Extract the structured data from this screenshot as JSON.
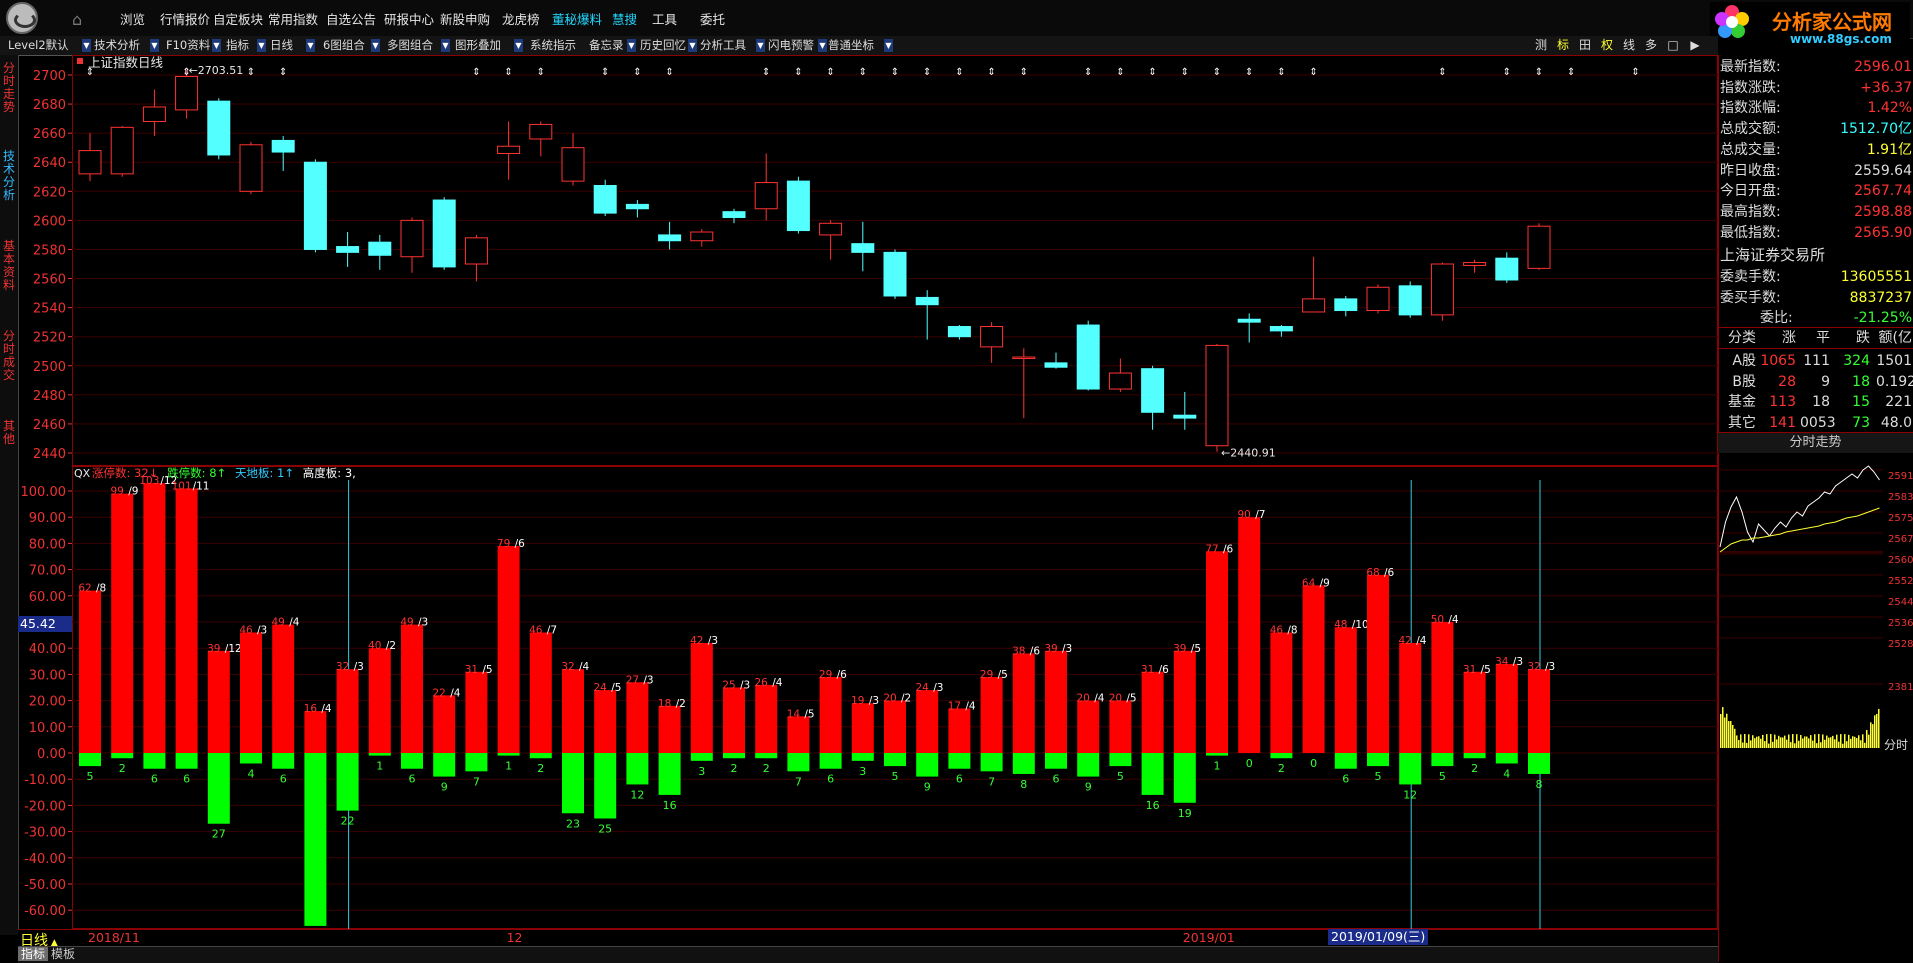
{
  "menu": {
    "items": [
      "浏览",
      "行情报价",
      "自定板块",
      "常用指数",
      "自选公告",
      "研报中心",
      "新股申购",
      "龙虎榜",
      "董秘爆料",
      "慧搜",
      "工具",
      "委托"
    ],
    "highlight": [
      "董秘爆料",
      "慧搜"
    ]
  },
  "brand": {
    "name": "分析家公式网",
    "url": "www.88gs.com"
  },
  "toolbar": {
    "items": [
      "Level2默认",
      "技术分析",
      "F10资料",
      "指标",
      "日线",
      "6图组合",
      "多图组合",
      "图形叠加",
      "系统指示",
      "备忘录",
      "历史回忆",
      "分析工具",
      "闪电预警",
      "普通坐标"
    ],
    "right": [
      "测",
      "标",
      "田",
      "权",
      "线",
      "多",
      "□",
      "▶"
    ],
    "right_active": [
      "标",
      "权"
    ]
  },
  "left_tabs": [
    "分时走势",
    "技术分析",
    "基本资料",
    "分时成交",
    "其他"
  ],
  "price_chart": {
    "title": "上证指数日线",
    "y_labels": [
      "2700",
      "2680",
      "2660",
      "2640",
      "2620",
      "2600",
      "2580",
      "2560",
      "2540",
      "2520",
      "2500",
      "2480",
      "2460",
      "2440"
    ],
    "high_label": "2703.51",
    "low_label": "2440.91",
    "candles": [
      {
        "o": 2632,
        "c": 2648,
        "h": 2660,
        "l": 2627
      },
      {
        "o": 2632,
        "c": 2664,
        "h": 2665,
        "l": 2630
      },
      {
        "o": 2668,
        "c": 2678,
        "h": 2690,
        "l": 2658
      },
      {
        "o": 2676,
        "c": 2699,
        "h": 2703.51,
        "l": 2670
      },
      {
        "o": 2682,
        "c": 2645,
        "h": 2684,
        "l": 2642
      },
      {
        "o": 2620,
        "c": 2652,
        "h": 2654,
        "l": 2618
      },
      {
        "o": 2655,
        "c": 2647,
        "h": 2658,
        "l": 2634
      },
      {
        "o": 2640,
        "c": 2580,
        "h": 2642,
        "l": 2578
      },
      {
        "o": 2582,
        "c": 2578,
        "h": 2592,
        "l": 2568
      },
      {
        "o": 2585,
        "c": 2576,
        "h": 2590,
        "l": 2566
      },
      {
        "o": 2575,
        "c": 2600,
        "h": 2602,
        "l": 2564
      },
      {
        "o": 2614,
        "c": 2568,
        "h": 2616,
        "l": 2566
      },
      {
        "o": 2570,
        "c": 2588,
        "h": 2590,
        "l": 2558
      },
      {
        "o": 2646,
        "c": 2651,
        "h": 2668,
        "l": 2628
      },
      {
        "o": 2656,
        "c": 2666,
        "h": 2668,
        "l": 2644
      },
      {
        "o": 2627,
        "c": 2650,
        "h": 2660,
        "l": 2624
      },
      {
        "o": 2624,
        "c": 2605,
        "h": 2628,
        "l": 2603
      },
      {
        "o": 2611,
        "c": 2608,
        "h": 2614,
        "l": 2602
      },
      {
        "o": 2590,
        "c": 2586,
        "h": 2599,
        "l": 2580
      },
      {
        "o": 2586,
        "c": 2592,
        "h": 2594,
        "l": 2582
      },
      {
        "o": 2606,
        "c": 2602,
        "h": 2608,
        "l": 2598
      },
      {
        "o": 2608,
        "c": 2626,
        "h": 2646,
        "l": 2600
      },
      {
        "o": 2627,
        "c": 2593,
        "h": 2630,
        "l": 2591
      },
      {
        "o": 2590,
        "c": 2598,
        "h": 2600,
        "l": 2573
      },
      {
        "o": 2584,
        "c": 2578,
        "h": 2599,
        "l": 2565
      },
      {
        "o": 2578,
        "c": 2548,
        "h": 2580,
        "l": 2546
      },
      {
        "o": 2547,
        "c": 2542,
        "h": 2552,
        "l": 2518
      },
      {
        "o": 2527,
        "c": 2520,
        "h": 2528,
        "l": 2518
      },
      {
        "o": 2513,
        "c": 2527,
        "h": 2530,
        "l": 2502
      },
      {
        "o": 2505,
        "c": 2506,
        "h": 2512,
        "l": 2464
      },
      {
        "o": 2502,
        "c": 2499,
        "h": 2509,
        "l": 2498
      },
      {
        "o": 2528,
        "c": 2484,
        "h": 2531,
        "l": 2483
      },
      {
        "o": 2484,
        "c": 2495,
        "h": 2505,
        "l": 2482
      },
      {
        "o": 2498,
        "c": 2468,
        "h": 2500,
        "l": 2456
      },
      {
        "o": 2466,
        "c": 2464,
        "h": 2482,
        "l": 2456
      },
      {
        "o": 2445,
        "c": 2514,
        "h": 2515,
        "l": 2440.91
      },
      {
        "o": 2532,
        "c": 2530,
        "h": 2536,
        "l": 2516
      },
      {
        "o": 2527,
        "c": 2524,
        "h": 2528,
        "l": 2520
      },
      {
        "o": 2537,
        "c": 2546,
        "h": 2575,
        "l": 2537
      },
      {
        "o": 2546,
        "c": 2538,
        "h": 2548,
        "l": 2534
      },
      {
        "o": 2538,
        "c": 2554,
        "h": 2556,
        "l": 2536
      },
      {
        "o": 2555,
        "c": 2535,
        "h": 2558,
        "l": 2533
      },
      {
        "o": 2535,
        "c": 2570,
        "h": 2571,
        "l": 2531
      },
      {
        "o": 2569,
        "c": 2571,
        "h": 2573,
        "l": 2564
      },
      {
        "o": 2574,
        "c": 2559,
        "h": 2578,
        "l": 2557
      },
      {
        "o": 2567,
        "c": 2596,
        "h": 2598,
        "l": 2566
      }
    ],
    "markers": [
      0,
      3,
      5,
      6,
      12,
      13,
      14,
      16,
      17,
      18,
      21,
      22,
      23,
      24,
      25,
      26,
      27,
      28,
      29,
      31,
      32,
      33,
      34,
      35,
      36,
      37,
      38,
      42,
      44,
      45,
      46,
      48,
      52,
      54,
      55,
      56,
      57
    ]
  },
  "indicator": {
    "title": "QX",
    "legend": [
      {
        "label": "涨停数: 32↓",
        "color": "#ff3333"
      },
      {
        "label": "跌停数: 8↑",
        "color": "#33ff33"
      },
      {
        "label": "天地板: 1↑",
        "color": "#33ccff"
      },
      {
        "label": "高度板: 3,",
        "color": "#ffffff"
      }
    ],
    "y_labels": [
      "100.00",
      "90.00",
      "80.00",
      "70.00",
      "60.00",
      "50.00",
      "40.00",
      "30.00",
      "20.00",
      "10.00",
      "0.00",
      "-10.00",
      "-20.00",
      "-30.00",
      "-40.00",
      "-50.00",
      "-60.00"
    ],
    "cursor_value": "45.42",
    "up": [
      62,
      99,
      103,
      101,
      39,
      46,
      49,
      16,
      32,
      40,
      49,
      22,
      31,
      79,
      46,
      32,
      24,
      27,
      18,
      42,
      25,
      26,
      14,
      29,
      19,
      20,
      24,
      17,
      29,
      38,
      39,
      20,
      20,
      31,
      39,
      77,
      90,
      46,
      64,
      48,
      68,
      42,
      50,
      31,
      34,
      32
    ],
    "up_label": [
      "62/8",
      "99/9",
      "103/12",
      "101/11",
      "39/12",
      "46/3",
      "49/4",
      "16/4",
      "32/3",
      "40/2",
      "49/3",
      "22/4",
      "31/5",
      "79/6",
      "46/7",
      "32/4",
      "24/5",
      "27/3",
      "18/2",
      "42/3",
      "25/3",
      "26/4",
      "14/5",
      "29/6",
      "19/3",
      "20/2",
      "24/3",
      "17/4",
      "29/5",
      "38/6",
      "39/3",
      "20/4",
      "20/5",
      "31/6",
      "39/5",
      "77/6",
      "90/7",
      "46/8",
      "64/9",
      "48/10",
      "68/6",
      "42/4",
      "50/4",
      "31/5",
      "34/3",
      "32/3"
    ],
    "down": [
      5,
      2,
      6,
      6,
      27,
      4,
      6,
      66,
      22,
      1,
      6,
      9,
      7,
      1,
      2,
      23,
      25,
      12,
      16,
      3,
      2,
      2,
      7,
      6,
      3,
      5,
      9,
      6,
      7,
      8,
      6,
      9,
      5,
      16,
      19,
      1,
      0,
      2,
      0,
      6,
      5,
      12,
      5,
      2,
      4,
      8
    ],
    "vlines": [
      8,
      41,
      45
    ]
  },
  "date_axis": {
    "period": "日线",
    "labels": [
      {
        "text": "2018/11",
        "idx": 0
      },
      {
        "text": "12",
        "idx": 13
      },
      {
        "text": "2019/01",
        "idx": 34
      }
    ],
    "cursor": "2019/01/09(三)"
  },
  "bottom_tabs": [
    "指标",
    "模板"
  ],
  "right_panel": {
    "quote": [
      {
        "k": "最新指数:",
        "v": "2596.01",
        "c": "#ff3333"
      },
      {
        "k": "指数涨跌:",
        "v": "+36.37",
        "c": "#ff3333"
      },
      {
        "k": "指数涨幅:",
        "v": "1.42%",
        "c": "#ff3333"
      },
      {
        "k": "总成交额:",
        "v": "1512.70亿",
        "c": "#33ffff"
      },
      {
        "k": "总成交量:",
        "v": "1.91亿",
        "c": "#ffff33"
      },
      {
        "k": "昨日收盘:",
        "v": "2559.64",
        "c": "#dddddd"
      },
      {
        "k": "今日开盘:",
        "v": "2567.74",
        "c": "#ff3333"
      },
      {
        "k": "最高指数:",
        "v": "2598.88",
        "c": "#ff3333"
      },
      {
        "k": "最低指数:",
        "v": "2565.90",
        "c": "#ff3333"
      }
    ],
    "exchange": "上海证券交易所",
    "orders": [
      {
        "k": "委卖手数:",
        "v": "13605551",
        "c": "#ffff33"
      },
      {
        "k": "委买手数:",
        "v": "8837237",
        "c": "#ffff33"
      },
      {
        "k": "委比:",
        "v": "-21.25%",
        "c": "#33ff33"
      }
    ],
    "cls_header": [
      "分类",
      "涨",
      "平",
      "跌",
      "额(亿"
    ],
    "cls_rows": [
      {
        "name": "A股",
        "up": "1065",
        "flat": "111",
        "down": "324",
        "amt": "1501"
      },
      {
        "name": "B股",
        "up": "28",
        "flat": "9",
        "down": "18",
        "amt": "0.192"
      },
      {
        "name": "基金",
        "up": "113",
        "flat": "18",
        "down": "15",
        "amt": "221"
      },
      {
        "name": "其它",
        "up": "141",
        "flat": "0053",
        "down": "73",
        "amt": "48.0"
      }
    ],
    "mini_title": "分时走势",
    "mini_y": [
      "2591",
      "2583",
      "2575",
      "2567",
      "2560",
      "2552",
      "2544",
      "2536",
      "2528"
    ],
    "mini_y2": "2381",
    "mini_foot": "分时"
  },
  "colors": {
    "up": "#ff0000",
    "down_bar": "#00ff00",
    "cyan": "#54ffff",
    "frame": "#8b0000",
    "axis": "#ee3333"
  }
}
